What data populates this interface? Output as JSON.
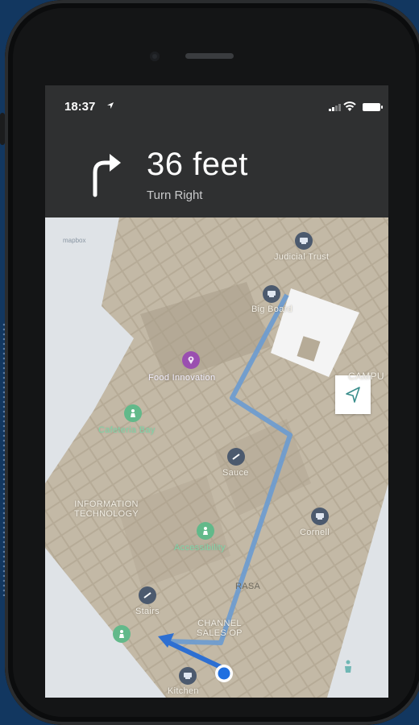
{
  "colors": {
    "background": "#123760",
    "header": "#2f3031",
    "map_water": "#dfe3e7",
    "building": "#b8ad98",
    "route": "#5b8fc9",
    "user_dot": "#1f6fe0"
  },
  "status": {
    "time": "18:37"
  },
  "navigation": {
    "distance": "36 feet",
    "instruction": "Turn Right",
    "turn_icon": "turn-right-arrow-icon"
  },
  "map": {
    "attribution": "mapbox",
    "labels": {
      "judicial_trust": "Judicial Trust",
      "big_board": "Big Board",
      "food_innovation": "Food Innovation",
      "campus": "CAMPU",
      "cafeteria": "Cafeteria Bay",
      "sauce": "Sauce",
      "information_technology": "INFORMATION\nTECHNOLOGY",
      "cornell": "Cornell",
      "accessibility": "Accessibility",
      "rasa": "RASA",
      "stairs": "Stairs",
      "channel_sales": "CHANNEL\nSALES OP",
      "kitchen": "Kitchen"
    },
    "icons": {
      "locate": "locate-arrow-icon",
      "meeting": "meeting-room-icon",
      "poi": "place-pin-icon",
      "restroom": "restroom-icon",
      "stairs": "stairs-icon",
      "elevator": "elevator-icon"
    }
  }
}
